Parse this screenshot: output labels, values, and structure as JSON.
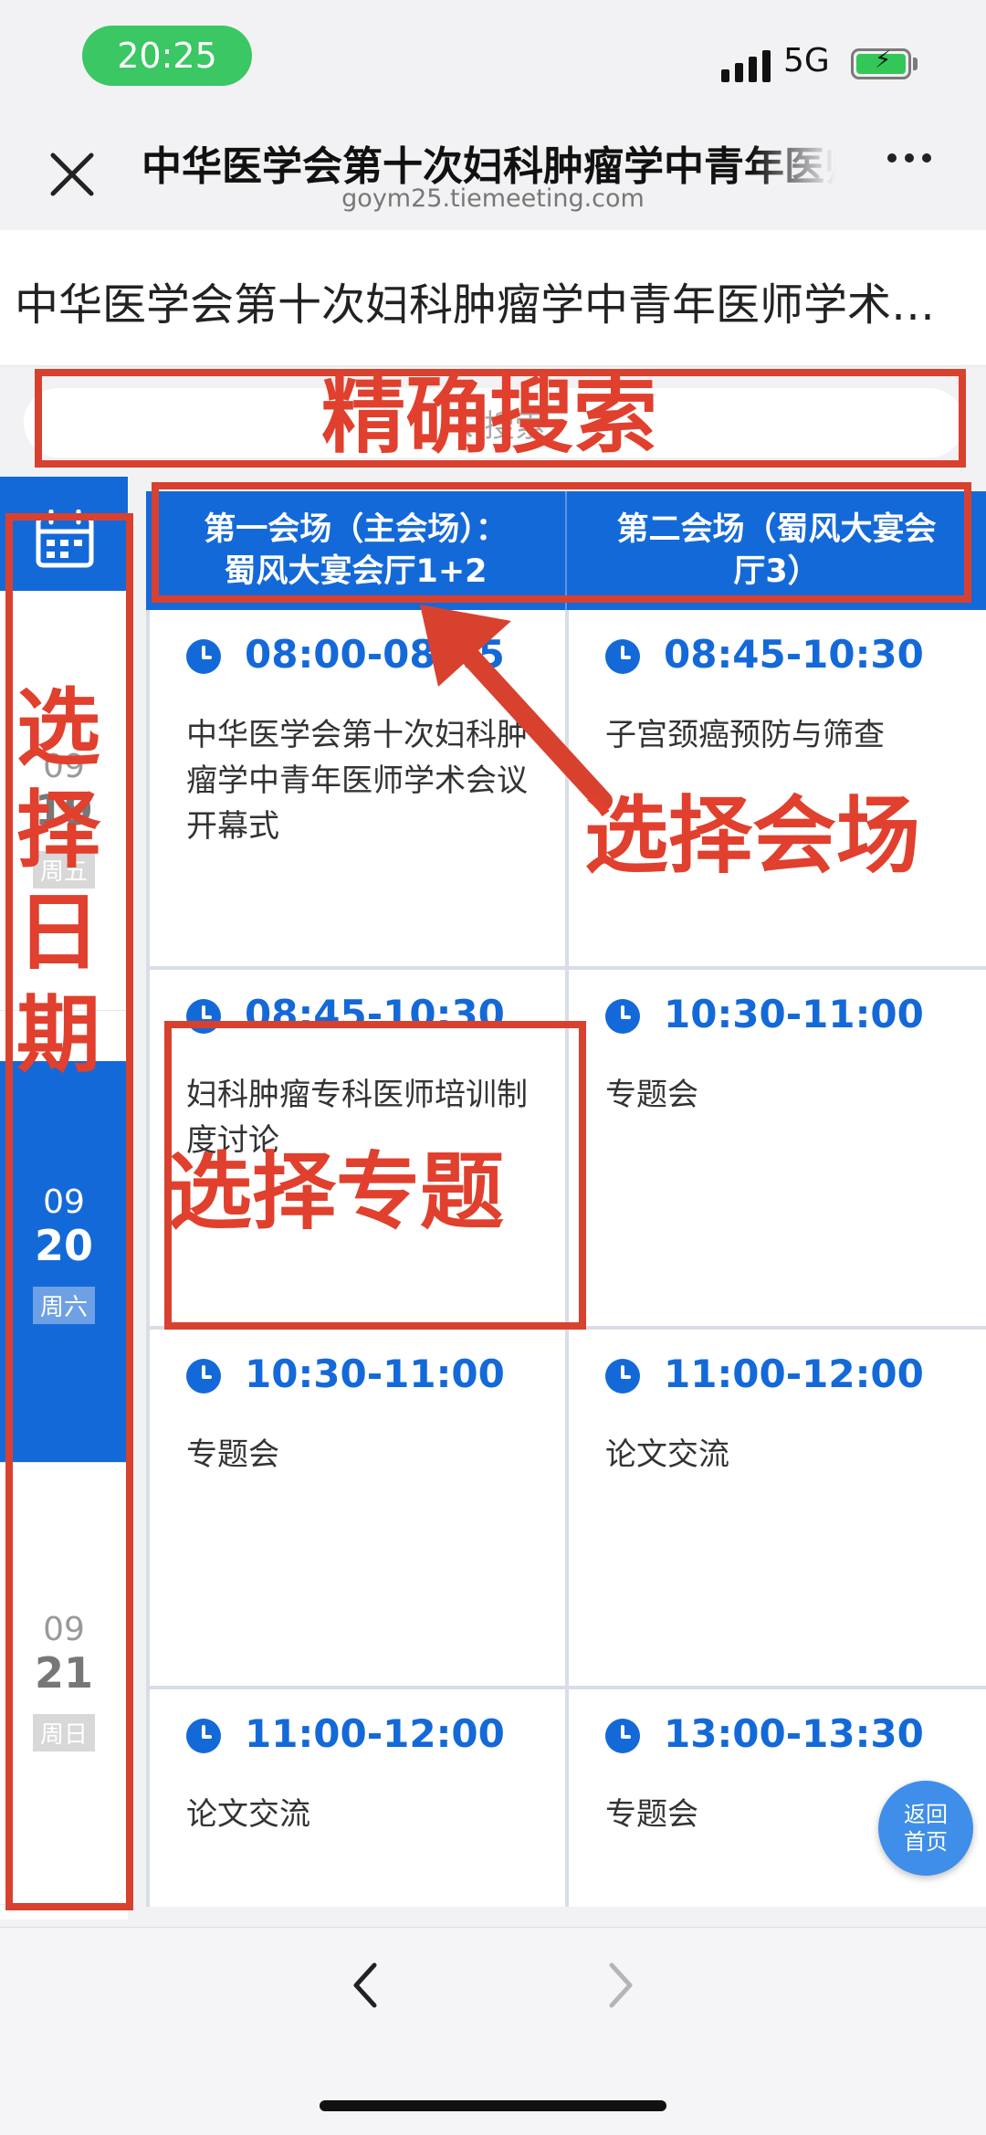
{
  "status_bar": {
    "time": "20:25",
    "network": "5G"
  },
  "nav": {
    "title": "中华医学会第十次妇科肿瘤学中青年医师学术会议",
    "domain": "goym25.tiemeeting.com"
  },
  "page_header": {
    "title": "中华医学会第十次妇科肿瘤学中青年医师学术会议"
  },
  "search": {
    "placeholder": "搜索"
  },
  "dates": [
    {
      "month": "09",
      "day": "19",
      "weekday": "周五",
      "active": false
    },
    {
      "month": "09",
      "day": "20",
      "weekday": "周六",
      "active": true
    },
    {
      "month": "09",
      "day": "21",
      "weekday": "周日",
      "active": false
    }
  ],
  "venues": [
    {
      "line1": "第一会场（主会场）：",
      "line2": "蜀风大宴会厅1+2"
    },
    {
      "line1": "第二会场（蜀风大宴会",
      "line2": "厅3）"
    }
  ],
  "sessions": [
    {
      "time": "08:00-08:45",
      "desc": "中华医学会第十次妇科肿瘤学中青年医师学术会议开幕式"
    },
    {
      "time": "08:45-10:30",
      "desc": "子宫颈癌预防与筛查"
    },
    {
      "time": "08:45-10:30",
      "desc": "妇科肿瘤专科医师培训制度讨论"
    },
    {
      "time": "10:30-11:00",
      "desc": "专题会"
    },
    {
      "time": "10:30-11:00",
      "desc": "专题会"
    },
    {
      "time": "11:00-12:00",
      "desc": "论文交流"
    },
    {
      "time": "11:00-12:00",
      "desc": "论文交流"
    },
    {
      "time": "13:00-13:30",
      "desc": "专题会"
    }
  ],
  "home_button": {
    "line1": "返回",
    "line2": "首页"
  },
  "annotations": {
    "search": "精确搜索",
    "venue": "选择会场",
    "date": [
      "选",
      "择",
      "日",
      "期"
    ],
    "topic": "选择专题"
  },
  "colors": {
    "primary": "#1469d8",
    "annotation": "#d9412f",
    "status_green": "#3ac764"
  }
}
